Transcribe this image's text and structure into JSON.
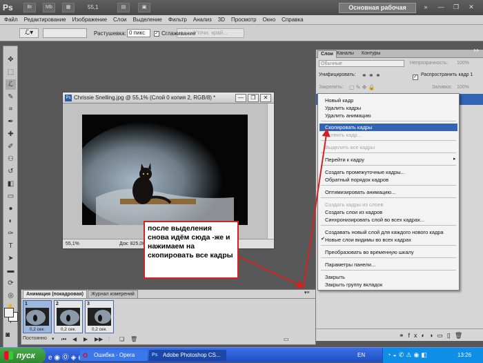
{
  "app": {
    "logo": "Ps",
    "bridge_label": "Br",
    "mini_label": "Mb",
    "zoom": "55,1",
    "workspace": "Основная рабочая среда"
  },
  "menu": [
    "Файл",
    "Редактирование",
    "Изображение",
    "Слои",
    "Выделение",
    "Фильтр",
    "Анализ",
    "3D",
    "Просмотр",
    "Окно",
    "Справка"
  ],
  "options": {
    "feather_label": "Растушевка:",
    "feather_value": "0 пикс",
    "antialias_label": "Сглаживание",
    "refine_button": "Уточн. край..."
  },
  "document": {
    "title": "Chrissie Snelling.jpg @ 55,1% (Слой 0 копия 2, RGB/8) *",
    "zoom": "55,1%",
    "doc_info": "Док: 825,0К"
  },
  "panel": {
    "tabs": [
      "Слои",
      "Каналы",
      "Контуры"
    ],
    "blend_mode": "Обычные",
    "opacity_label": "Непрозрачность:",
    "opacity_value": "100%",
    "unify_label": "Унифицировать:",
    "propagate_label": "Распространить кадр 1",
    "lock_label": "Закрепить:",
    "fill_label": "Заливка:",
    "fill_value": "100%"
  },
  "context_menu": {
    "items": [
      {
        "label": "Новый кадр",
        "state": "normal"
      },
      {
        "label": "Удалить кадры",
        "state": "normal"
      },
      {
        "label": "Удалить анимацию",
        "state": "normal"
      },
      {
        "label": "Скопировать кадры",
        "state": "highlight"
      },
      {
        "label": "Вклеить кадр...",
        "state": "disabled"
      },
      {
        "label": "Выделить все кадры",
        "state": "disabled"
      },
      {
        "label": "Перейти к кадру",
        "state": "normal"
      },
      {
        "label": "Создать промежуточные кадры...",
        "state": "normal"
      },
      {
        "label": "Обратный порядок кадров",
        "state": "normal"
      },
      {
        "label": "Оптимизировать анимацию...",
        "state": "normal"
      },
      {
        "label": "Создать кадры из слоев",
        "state": "disabled"
      },
      {
        "label": "Создать слои из кадров",
        "state": "normal"
      },
      {
        "label": "Синхронизировать слой во всех кадрах...",
        "state": "normal"
      },
      {
        "label": "Создавать новый слой для каждого нового кадра",
        "state": "normal"
      },
      {
        "label": "Новые слои видимы во всех кадрах",
        "state": "checked"
      },
      {
        "label": "Преобразовать во временную шкалу",
        "state": "normal"
      },
      {
        "label": "Параметры панели...",
        "state": "normal"
      },
      {
        "label": "Закрыть",
        "state": "normal"
      },
      {
        "label": "Закрыть группу вкладок",
        "state": "normal"
      }
    ]
  },
  "animation": {
    "tabs": [
      "Анимация (покадровая)",
      "Журнал измерений"
    ],
    "frames": [
      {
        "number": "1",
        "delay": "0,2 сек."
      },
      {
        "number": "2",
        "delay": "0,2 сек."
      },
      {
        "number": "3",
        "delay": "0,2 сек."
      }
    ],
    "loop": "Постоянно"
  },
  "annotation": {
    "text": "после выделения снова идём сюда -же и нажимаем на скопировать все кадры"
  },
  "taskbar": {
    "start": "пуск",
    "tasks": [
      "Ошибка - Opera",
      "Adobe Photoshop CS..."
    ],
    "language": "EN",
    "clock": "13:26"
  },
  "colors": {
    "annotation_red": "#d42020",
    "menu_highlight": "#3264b4",
    "frame_border": "#3e68b4"
  }
}
